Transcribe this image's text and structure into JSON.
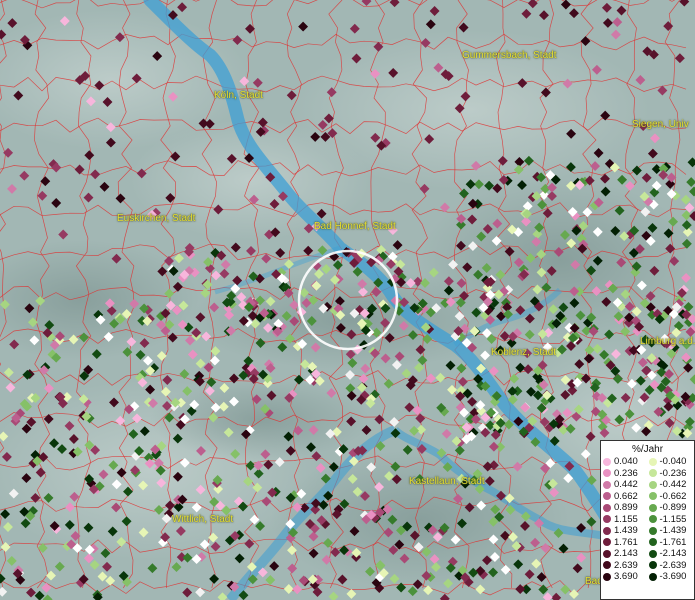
{
  "map": {
    "cities": [
      {
        "id": "koeln",
        "label": "Köln, Stadt"
      },
      {
        "id": "gummersbach",
        "label": "Gummersbach, Stadt"
      },
      {
        "id": "siegen",
        "label": "Siegen, Univ"
      },
      {
        "id": "euskirchen",
        "label": "Euskirchen, Stadt"
      },
      {
        "id": "bad-honnef",
        "label": "Bad Honnef, Stadt"
      },
      {
        "id": "koblenz",
        "label": "Koblenz, Stadt"
      },
      {
        "id": "limburg",
        "label": "Limburg a.d."
      },
      {
        "id": "kastellaun",
        "label": "Kastellaun, Stadt"
      },
      {
        "id": "wittlich",
        "label": "Wittlich, Stadt"
      },
      {
        "id": "bad",
        "label": "Bad"
      }
    ],
    "colors": {
      "terrain": "#9fb4b1",
      "river": "#3d9fd4",
      "boundary": "#e03030",
      "label": "#e6e033",
      "selection_ring": "#ffffff"
    }
  },
  "legend": {
    "title": "%/Jahr",
    "positive": [
      {
        "value": "0.040",
        "color": "#f7b6dc"
      },
      {
        "value": "0.236",
        "color": "#e991c2"
      },
      {
        "value": "0.442",
        "color": "#d07aa8"
      },
      {
        "value": "0.662",
        "color": "#bc5f8e"
      },
      {
        "value": "0.899",
        "color": "#a94a76"
      },
      {
        "value": "1.155",
        "color": "#963a62"
      },
      {
        "value": "1.439",
        "color": "#822a4e"
      },
      {
        "value": "1.761",
        "color": "#6e1d3b"
      },
      {
        "value": "2.143",
        "color": "#58122b"
      },
      {
        "value": "2.639",
        "color": "#420a1d"
      },
      {
        "value": "3.690",
        "color": "#2a0410"
      }
    ],
    "negative": [
      {
        "value": "-0.040",
        "color": "#e6f5b5"
      },
      {
        "value": "-0.236",
        "color": "#c6e79a"
      },
      {
        "value": "-0.442",
        "color": "#a6d581"
      },
      {
        "value": "-0.662",
        "color": "#86c168"
      },
      {
        "value": "-0.899",
        "color": "#67a950"
      },
      {
        "value": "-1.155",
        "color": "#4c923c"
      },
      {
        "value": "-1.439",
        "color": "#357a2b"
      },
      {
        "value": "-1.761",
        "color": "#22631e"
      },
      {
        "value": "-2.143",
        "color": "#124b12"
      },
      {
        "value": "-2.639",
        "color": "#08350a"
      },
      {
        "value": "-3.690",
        "color": "#032004"
      }
    ]
  }
}
